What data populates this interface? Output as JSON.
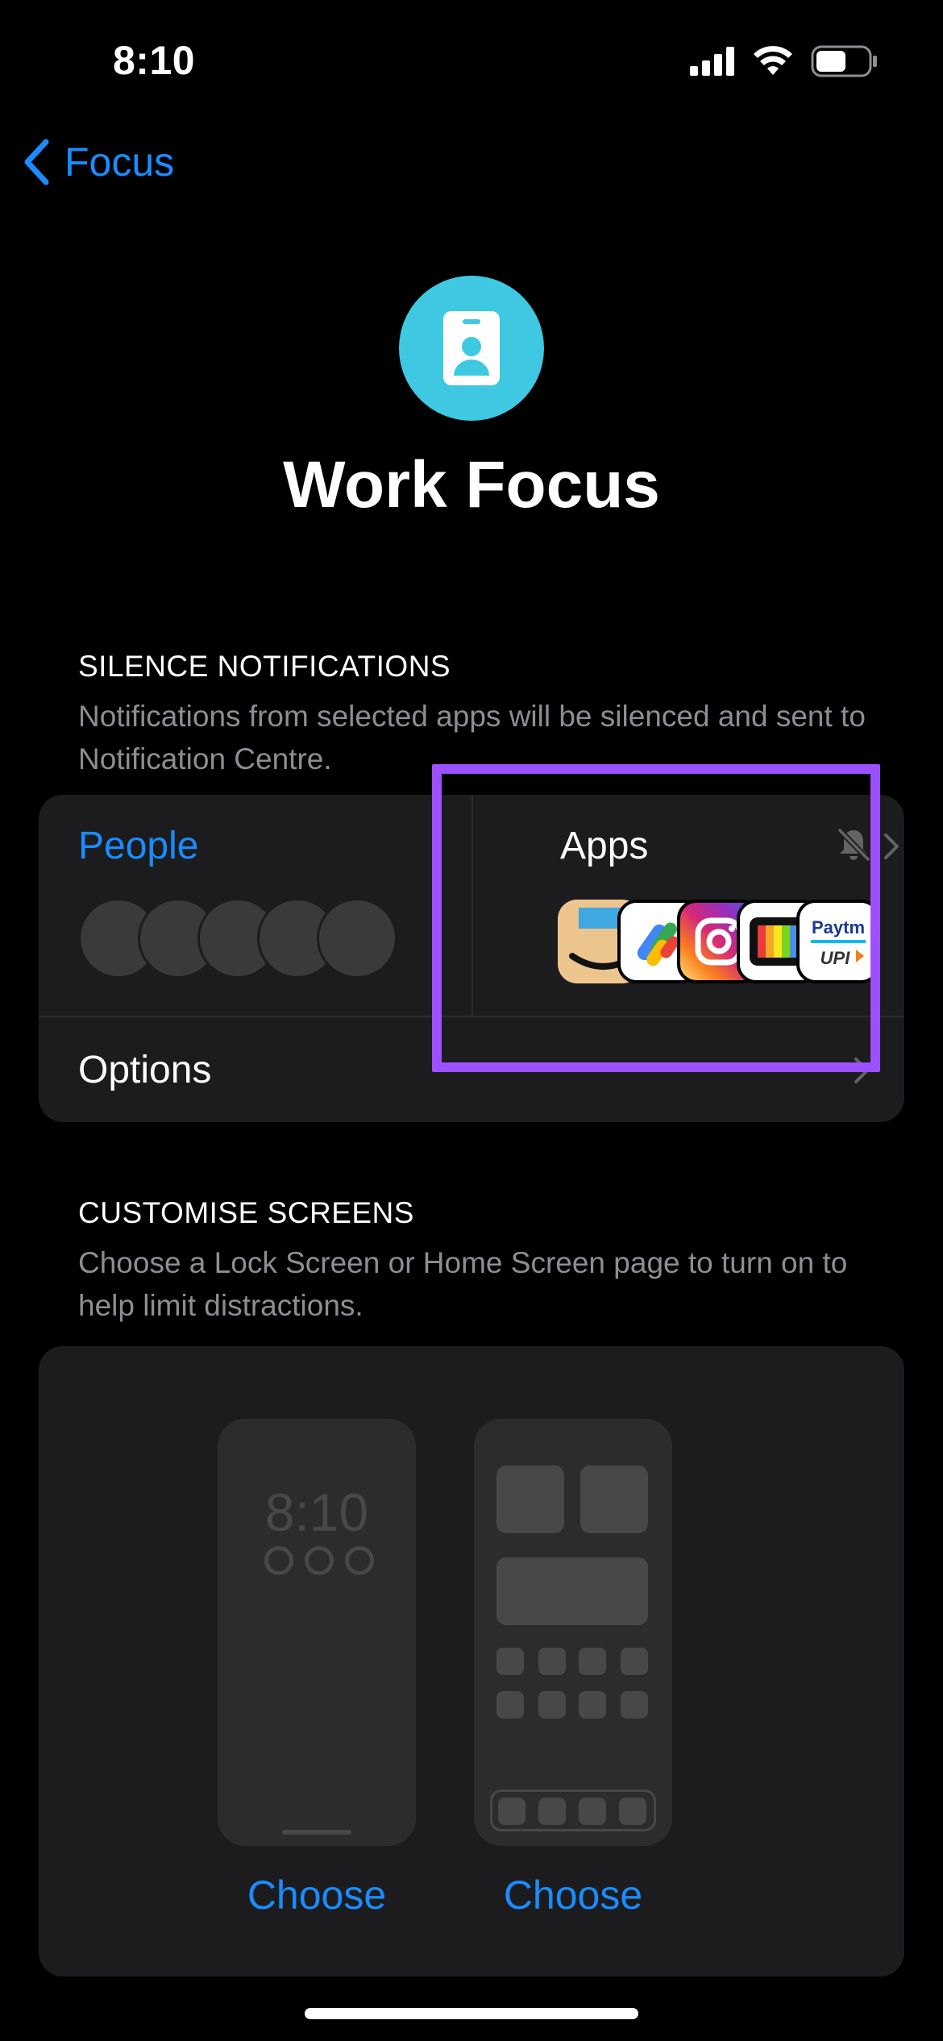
{
  "status_bar": {
    "time": "8:10",
    "icons": [
      "cellular-signal-icon",
      "wifi-icon",
      "battery-icon"
    ]
  },
  "nav": {
    "back_label": "Focus",
    "back_icon": "chevron-left-icon"
  },
  "header": {
    "icon": "id-badge-icon",
    "icon_color": "#3fc8e2",
    "title": "Work Focus"
  },
  "silence_section": {
    "header": "SILENCE NOTIFICATIONS",
    "description": "Notifications from selected apps will be silenced and sent to Notification Centre.",
    "people": {
      "label": "People",
      "avatar_count": 5
    },
    "apps": {
      "label": "Apps",
      "status_icon": "bell-slash-icon",
      "app_icons": [
        {
          "name": "amazon-app-icon",
          "text": ""
        },
        {
          "name": "google-pay-app-icon",
          "text": ""
        },
        {
          "name": "instagram-app-icon",
          "text": ""
        },
        {
          "name": "tv-app-icon",
          "text": ""
        },
        {
          "name": "paytm-app-icon",
          "text": "Paytm"
        }
      ]
    },
    "options": {
      "label": "Options"
    }
  },
  "customise_section": {
    "header": "CUSTOMISE SCREENS",
    "description": "Choose a Lock Screen or Home Screen page to turn on to help limit distractions.",
    "lock_screen": {
      "time": "8:10",
      "choose_label": "Choose"
    },
    "home_screen": {
      "choose_label": "Choose"
    }
  },
  "colors": {
    "accent": "#1a8cff",
    "highlight": "#9d50ff",
    "background": "#000000",
    "card": "#1c1c1e"
  }
}
